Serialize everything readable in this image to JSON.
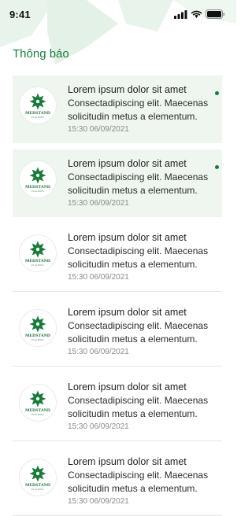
{
  "status": {
    "time": "9:41"
  },
  "header": {
    "title": "Thông báo"
  },
  "brand": {
    "name": "MEDSTAND",
    "sub": "PHARMA",
    "accent": "#1e7a3e",
    "unread_bg": "#eef6ef"
  },
  "notifications": [
    {
      "title": "Lorem ipsum dolor sit amet",
      "body": "Consectadipiscing elit. Maecenas solicitudin metus a elementum.",
      "time": "15:30 06/09/2021",
      "unread": true
    },
    {
      "title": "Lorem ipsum dolor sit amet",
      "body": "Consectadipiscing elit. Maecenas solicitudin metus a elementum.",
      "time": "15:30 06/09/2021",
      "unread": true
    },
    {
      "title": "Lorem ipsum dolor sit amet",
      "body": "Consectadipiscing elit. Maecenas solicitudin metus a elementum.",
      "time": "15:30 06/09/2021",
      "unread": false
    },
    {
      "title": "Lorem ipsum dolor sit amet",
      "body": "Consectadipiscing elit. Maecenas solicitudin metus a elementum.",
      "time": "15:30 06/09/2021",
      "unread": false
    },
    {
      "title": "Lorem ipsum dolor sit amet",
      "body": "Consectadipiscing elit. Maecenas solicitudin metus a elementum.",
      "time": "15:30 06/09/2021",
      "unread": false
    },
    {
      "title": "Lorem ipsum dolor sit amet",
      "body": "Consectadipiscing elit. Maecenas solicitudin metus a elementum.",
      "time": "15:30 06/09/2021",
      "unread": false
    }
  ]
}
